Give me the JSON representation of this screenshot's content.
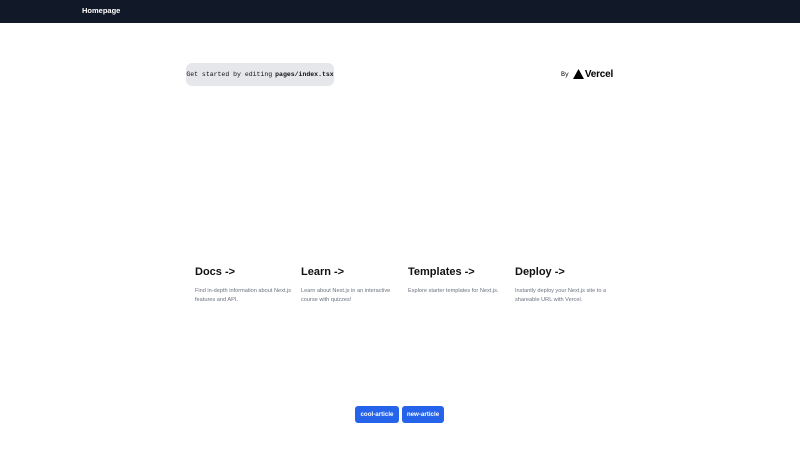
{
  "nav": {
    "title": "Homepage"
  },
  "intro": {
    "prefix": "Get started by editing",
    "file": "pages/index.tsx"
  },
  "vercel": {
    "by": "By",
    "brand": "Vercel",
    "icon": "triangle-icon"
  },
  "cards": [
    {
      "title": "Docs ->",
      "description": "Find in-depth information about Next.js features and API."
    },
    {
      "title": "Learn ->",
      "description": "Learn about Next.js in an interactive course with quizzes!"
    },
    {
      "title": "Templates ->",
      "description": "Explore starter templates for Next.js."
    },
    {
      "title": "Deploy ->",
      "description": "Instantly deploy your Next.js site to a shareable URL with Vercel."
    }
  ],
  "articles": [
    "cool-article",
    "new-article"
  ],
  "colors": {
    "navbar": "#111827",
    "button": "#2563eb",
    "code_bg": "#e5e7eb"
  }
}
